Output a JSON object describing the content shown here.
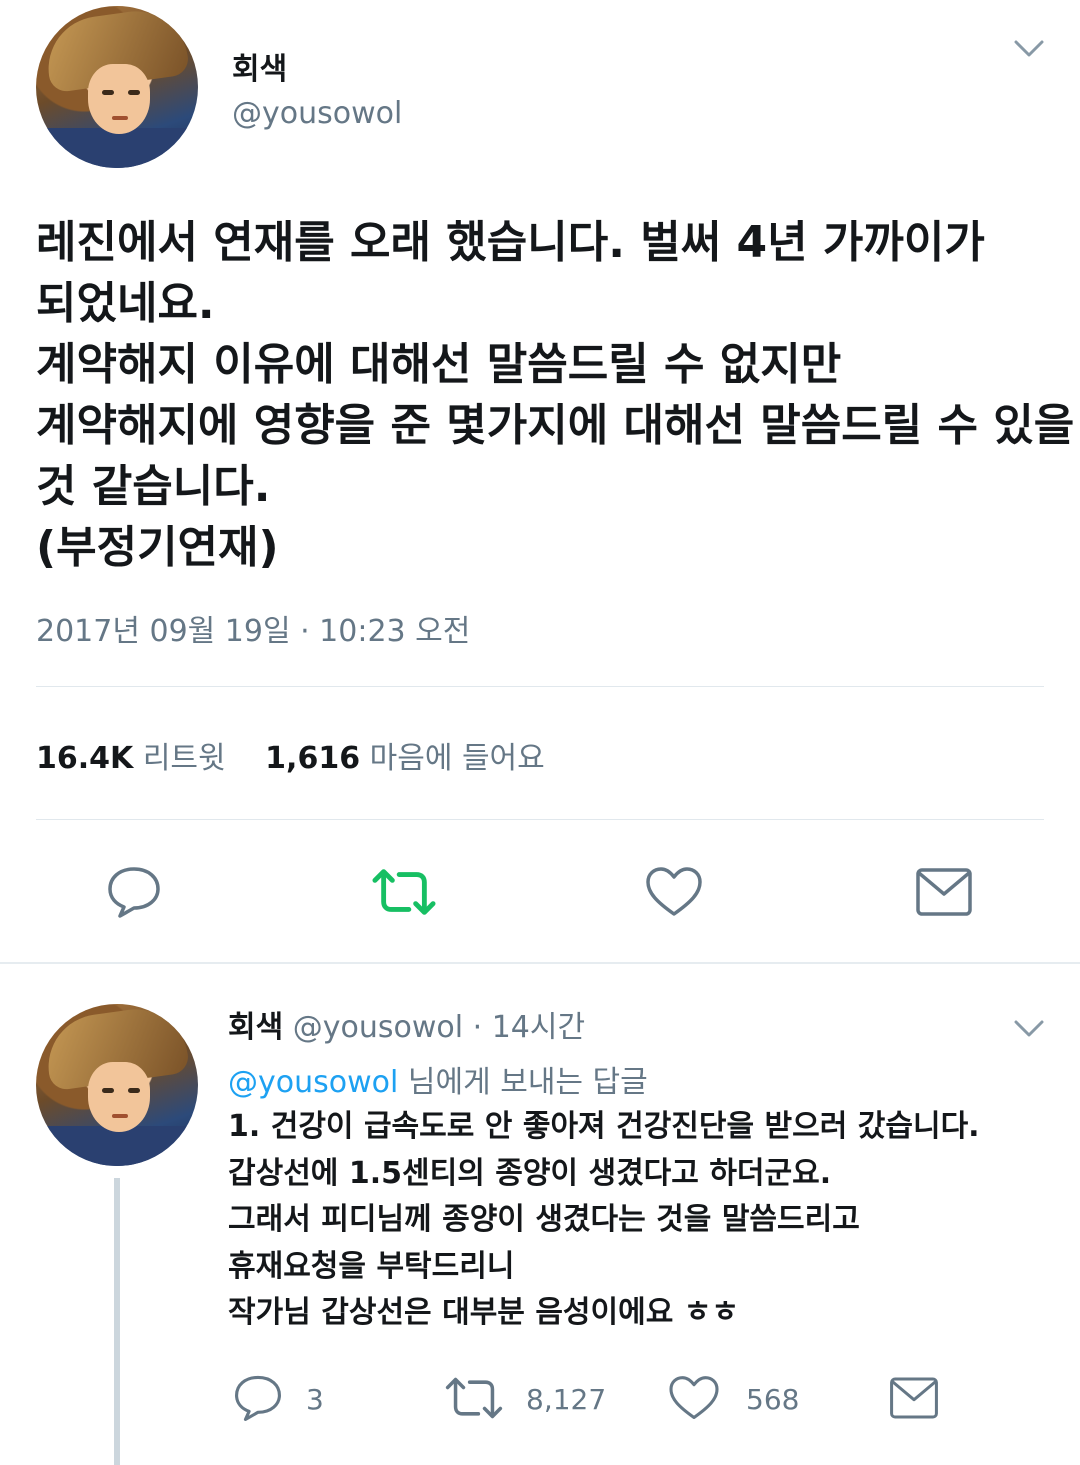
{
  "tweet": {
    "display_name": "회색",
    "handle": "@yousowol",
    "text_lines": [
      "레진에서 연재를 오래 했습니다.  벌써 4년 가까이가",
      "되었네요.",
      "계약해지 이유에 대해선 말씀드릴 수 없지만",
      "계약해지에 영향을 준 몇가지에 대해선 말씀드릴 수 있을",
      "것 같습니다.",
      "(부정기연재)"
    ],
    "timestamp": "2017년 09월 19일 · 10:23 오전",
    "stats": {
      "retweets_count": "16.4K",
      "retweets_label": "리트윗",
      "likes_count": "1,616",
      "likes_label": "마음에 들어요"
    },
    "actions": [
      "reply-icon",
      "retweet-icon",
      "like-icon",
      "dm-icon"
    ]
  },
  "reply": {
    "display_name": "회색",
    "handle": "@yousowol",
    "time": "· 14시간",
    "replying_mention": "@yousowol",
    "replying_suffix": " 님에게 보내는 답글",
    "text_lines": [
      "1. 건강이 급속도로 안 좋아져 건강진단을 받으러 갔습니다.",
      "갑상선에 1.5센티의 종양이 생겼다고 하더군요.",
      "그래서 피디님께 종양이 생겼다는 것을 말씀드리고",
      "휴재요청을 부탁드리니",
      "작가님 갑상선은 대부분 음성이에요 ㅎㅎ"
    ],
    "reply_count": "3",
    "retweet_count": "8,127",
    "like_count": "568"
  },
  "colors": {
    "retweet_active": "#17bf63",
    "icon_gray": "#657786",
    "link_blue": "#1da1f2"
  }
}
